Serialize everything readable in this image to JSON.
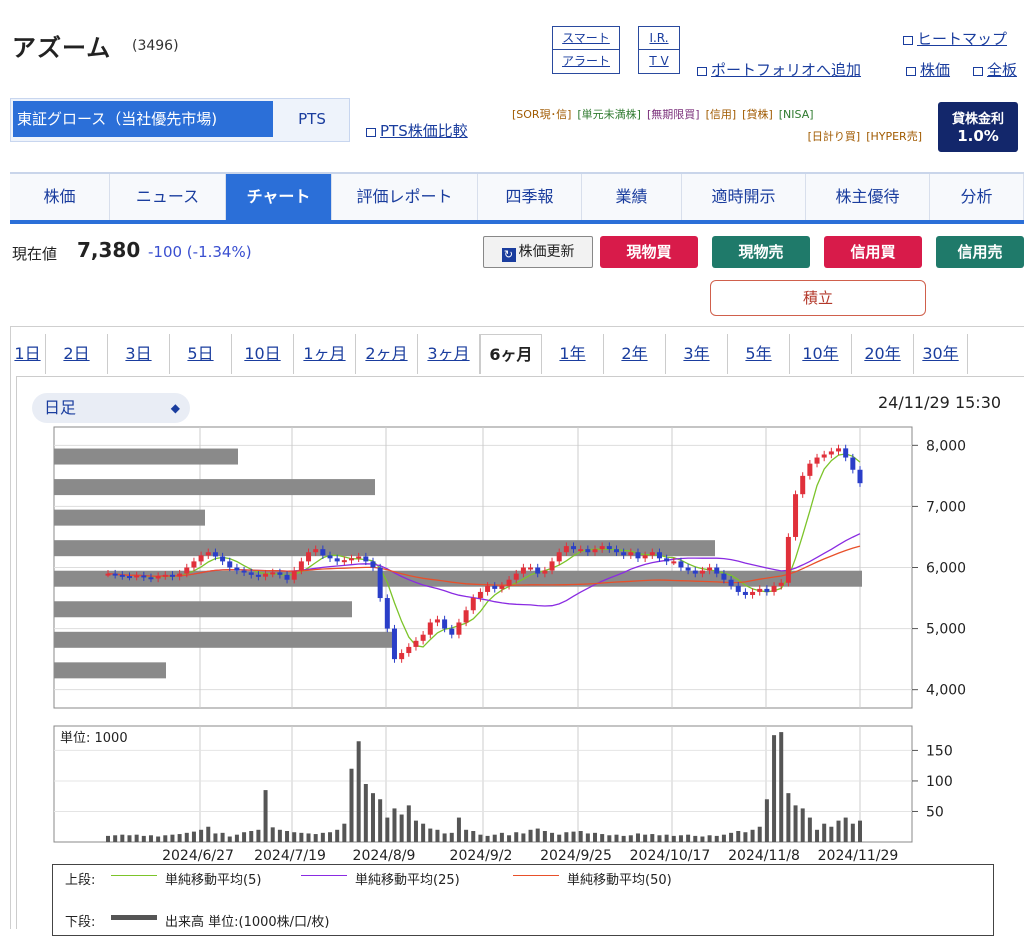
{
  "header": {
    "name": "アズーム",
    "code": "(3496)",
    "smart_alert": [
      "スマート",
      "アラート"
    ],
    "irtv": [
      "I.R.",
      "T V"
    ],
    "heatmap": "ヒートマップ",
    "add_portfolio": "ポートフォリオへ追加",
    "stock_price_link": "株価",
    "all_board": "全板"
  },
  "market": {
    "selected": "東証グロース（当社優先市場)",
    "pts": "PTS",
    "pts_compare": "PTS株価比較"
  },
  "tags": [
    "[SOR現･信]",
    "[単元未満株]",
    "[無期限買]",
    "[信用]",
    "[貸株]",
    "[NISA]",
    "[日計り買]",
    "[HYPER売]"
  ],
  "tag_colors": [
    "#a05a00",
    "#2f7a2f",
    "#7a2f7a",
    "#a05a00",
    "#a05a00",
    "#2f7a2f",
    "#a05a00",
    "#a05a00"
  ],
  "lending": {
    "label": "貸株金利",
    "rate": "1.0%"
  },
  "tabs": [
    "株価",
    "ニュース",
    "チャート",
    "評価レポート",
    "四季報",
    "業績",
    "適時開示",
    "株主優待",
    "分析"
  ],
  "quote": {
    "label": "現在値",
    "price": "7,380",
    "change": "-100 (-1.34%)"
  },
  "actions": {
    "refresh": "株価更新",
    "cash_buy": "現物買",
    "cash_sell": "現物売",
    "margin_buy": "信用買",
    "margin_sell": "信用売",
    "tsumitate": "積立"
  },
  "periods": [
    "1日",
    "2日",
    "3日",
    "5日",
    "10日",
    "1ヶ月",
    "2ヶ月",
    "3ヶ月",
    "6ヶ月",
    "1年",
    "2年",
    "3年",
    "5年",
    "10年",
    "20年",
    "30年"
  ],
  "period_active": "6ヶ月",
  "chart_controls": {
    "interval": "日足",
    "datetime": "24/11/29 15:30",
    "volume_unit": "単位: 1000"
  },
  "chart_data": {
    "type": "candlestick",
    "x_ticks": [
      "2024/6/27",
      "2024/7/19",
      "2024/8/9",
      "2024/9/2",
      "2024/9/25",
      "2024/10/17",
      "2024/11/8",
      "2024/11/29"
    ],
    "price_ticks": [
      "8,000",
      "7,000",
      "6,000",
      "5,000",
      "4,000"
    ],
    "ylim": [
      3700,
      8300
    ],
    "close_series": [
      5900,
      5880,
      5860,
      5850,
      5870,
      5840,
      5820,
      5860,
      5880,
      5850,
      5900,
      6000,
      6100,
      6200,
      6250,
      6180,
      6100,
      6000,
      5950,
      5920,
      5880,
      5850,
      5900,
      5920,
      5880,
      5800,
      5950,
      6100,
      6250,
      6300,
      6200,
      6150,
      6100,
      6120,
      6150,
      6180,
      6100,
      6000,
      5500,
      5000,
      4500,
      4600,
      4700,
      4800,
      4900,
      5100,
      5150,
      5000,
      4900,
      5100,
      5300,
      5500,
      5600,
      5700,
      5650,
      5700,
      5800,
      5900,
      6000,
      6000,
      5900,
      5950,
      6100,
      6250,
      6350,
      6300,
      6300,
      6250,
      6300,
      6350,
      6300,
      6250,
      6200,
      6250,
      6150,
      6200,
      6250,
      6150,
      6100,
      6100,
      6000,
      5950,
      5900,
      5950,
      6000,
      5900,
      5800,
      5700,
      5600,
      5550,
      5600,
      5650,
      5600,
      5700,
      5750,
      6500,
      7200,
      7500,
      7700,
      7800,
      7850,
      7900,
      7950,
      7800,
      7600,
      7380
    ],
    "volume_ticks": [
      "150",
      "100",
      "50"
    ],
    "vol_ylim": [
      0,
      190
    ],
    "volume": [
      10,
      11,
      12,
      11,
      12,
      10,
      11,
      9,
      11,
      12,
      13,
      15,
      17,
      20,
      25,
      14,
      15,
      9,
      12,
      16,
      18,
      20,
      85,
      24,
      20,
      18,
      16,
      15,
      14,
      13,
      15,
      16,
      20,
      30,
      120,
      165,
      95,
      80,
      70,
      40,
      55,
      45,
      60,
      35,
      30,
      22,
      20,
      14,
      15,
      40,
      20,
      18,
      12,
      10,
      12,
      15,
      11,
      16,
      14,
      20,
      22,
      18,
      15,
      12,
      16,
      17,
      18,
      14,
      15,
      13,
      11,
      12,
      10,
      11,
      14,
      12,
      13,
      11,
      12,
      10,
      11,
      12,
      10,
      9,
      11,
      10,
      12,
      15,
      18,
      16,
      20,
      25,
      70,
      175,
      180,
      80,
      60,
      55,
      40,
      20,
      30,
      25,
      35,
      40,
      30,
      35
    ],
    "ma_labels": [
      "上段:",
      "単純移動平均(5)",
      "単純移動平均(25)",
      "単純移動平均(50)"
    ],
    "ma_colors": [
      "#7cc42a",
      "#8a2be2",
      "#e8502a"
    ],
    "lower_label": [
      "下段:",
      "出来高 単位:(1000株/口/枚)"
    ]
  }
}
